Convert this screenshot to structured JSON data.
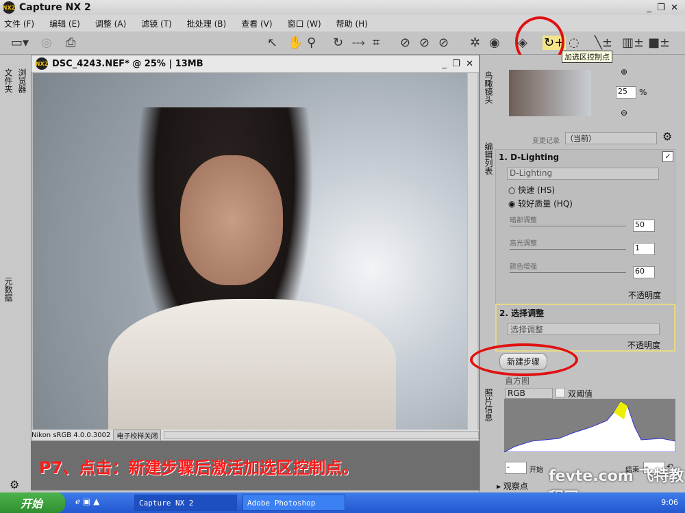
{
  "app": {
    "title": "Capture NX 2",
    "logo": "NX2"
  },
  "menu": [
    "文件 (F)",
    "编辑 (E)",
    "调整 (A)",
    "滤镜 (T)",
    "批处理 (B)",
    "查看 (V)",
    "窗口 (W)",
    "帮助 (H)"
  ],
  "tooltip": "加选区控制点",
  "document": {
    "title": "DSC_4243.NEF* @ 25% | 13MB",
    "profile": "Nikon sRGB 4.0.0.3002",
    "proof": "电子校样关闭"
  },
  "left_tabs": [
    "文件夹",
    "浏览器",
    "元数据"
  ],
  "birdseye": {
    "label": "鸟瞰镜头",
    "zoom": "25",
    "unit": "%"
  },
  "edit_list": {
    "label": "编辑列表",
    "history_label": "变更记录",
    "history_value": "（当前）",
    "step1": {
      "title": "1. D-Lighting",
      "select": "D-Lighting",
      "radio_fast": "快速 (HS)",
      "radio_hq": "较好质量 (HQ)",
      "sliders": [
        {
          "label": "暗部调整",
          "value": "50",
          "min": "1",
          "max": "100"
        },
        {
          "label": "高光调整",
          "value": "1",
          "min": "",
          "max": "100"
        },
        {
          "label": "颜色增强",
          "value": "60",
          "min": "0",
          "max": "100"
        }
      ],
      "opacity": "不透明度"
    },
    "step2": {
      "title": "2. 选择调整",
      "select": "选择调整",
      "opacity": "不透明度"
    },
    "new_step": "新建步骤"
  },
  "histogram": {
    "label": "直方图",
    "side_label": "照片信息",
    "channel": "RGB",
    "dual": "双阈值",
    "start_label": "开始",
    "end_label": "结束",
    "start": "-",
    "end": "-"
  },
  "watch": "观察点",
  "caption": "P7、点击：新建步骤后激活加选区控制点。",
  "watermark": "fevte.com 飞特教程网",
  "taskbar": {
    "start": "开始",
    "tasks": [
      "Capture NX 2",
      "Adobe Photoshop"
    ],
    "clock": "9:06"
  },
  "colors": {
    "annotation": "#e01010",
    "caption": "#ff1a1a"
  }
}
